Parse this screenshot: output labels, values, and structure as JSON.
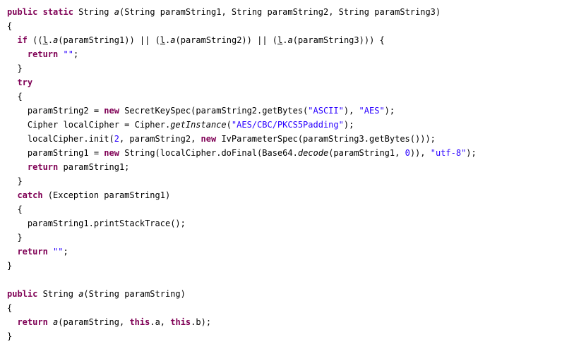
{
  "editor": {
    "lines": [
      [
        {
          "t": "public",
          "c": "kw"
        },
        {
          "t": " "
        },
        {
          "t": "static",
          "c": "kw"
        },
        {
          "t": " String "
        },
        {
          "t": "a",
          "c": "it"
        },
        {
          "t": "(String paramString1, String paramString2, String paramString3)"
        }
      ],
      [
        {
          "t": "{"
        }
      ],
      [
        {
          "t": "  "
        },
        {
          "t": "if",
          "c": "kw"
        },
        {
          "t": " (("
        },
        {
          "t": "l",
          "c": "ul"
        },
        {
          "t": "."
        },
        {
          "t": "a",
          "c": "it"
        },
        {
          "t": "(paramString1)) || ("
        },
        {
          "t": "l",
          "c": "ul"
        },
        {
          "t": "."
        },
        {
          "t": "a",
          "c": "it"
        },
        {
          "t": "(paramString2)) || ("
        },
        {
          "t": "l",
          "c": "ul"
        },
        {
          "t": "."
        },
        {
          "t": "a",
          "c": "it"
        },
        {
          "t": "(paramString3))) {"
        }
      ],
      [
        {
          "t": "    "
        },
        {
          "t": "return",
          "c": "kw"
        },
        {
          "t": " "
        },
        {
          "t": "\"\"",
          "c": "str"
        },
        {
          "t": ";"
        }
      ],
      [
        {
          "t": "  }"
        }
      ],
      [
        {
          "t": "  "
        },
        {
          "t": "try",
          "c": "kw"
        }
      ],
      [
        {
          "t": "  {"
        }
      ],
      [
        {
          "t": "    paramString2 = "
        },
        {
          "t": "new",
          "c": "kw"
        },
        {
          "t": " SecretKeySpec(paramString2.getBytes("
        },
        {
          "t": "\"ASCII\"",
          "c": "str"
        },
        {
          "t": "), "
        },
        {
          "t": "\"AES\"",
          "c": "str"
        },
        {
          "t": ");"
        }
      ],
      [
        {
          "t": "    Cipher localCipher = Cipher."
        },
        {
          "t": "getInstance",
          "c": "it"
        },
        {
          "t": "("
        },
        {
          "t": "\"AES/CBC/PKCS5Padding\"",
          "c": "str"
        },
        {
          "t": ");"
        }
      ],
      [
        {
          "t": "    localCipher.init("
        },
        {
          "t": "2",
          "c": "num"
        },
        {
          "t": ", paramString2, "
        },
        {
          "t": "new",
          "c": "kw"
        },
        {
          "t": " IvParameterSpec(paramString3.getBytes()));"
        }
      ],
      [
        {
          "t": "    paramString1 = "
        },
        {
          "t": "new",
          "c": "kw"
        },
        {
          "t": " String(localCipher.doFinal(Base64."
        },
        {
          "t": "decode",
          "c": "it"
        },
        {
          "t": "(paramString1, "
        },
        {
          "t": "0",
          "c": "num"
        },
        {
          "t": ")), "
        },
        {
          "t": "\"utf-8\"",
          "c": "str"
        },
        {
          "t": ");"
        }
      ],
      [
        {
          "t": "    "
        },
        {
          "t": "return",
          "c": "kw"
        },
        {
          "t": " paramString1;"
        }
      ],
      [
        {
          "t": "  }"
        }
      ],
      [
        {
          "t": "  "
        },
        {
          "t": "catch",
          "c": "kw"
        },
        {
          "t": " (Exception paramString1)"
        }
      ],
      [
        {
          "t": "  {"
        }
      ],
      [
        {
          "t": "    paramString1.printStackTrace();"
        }
      ],
      [
        {
          "t": "  }"
        }
      ],
      [
        {
          "t": "  "
        },
        {
          "t": "return",
          "c": "kw"
        },
        {
          "t": " "
        },
        {
          "t": "\"\"",
          "c": "str"
        },
        {
          "t": ";"
        }
      ],
      [
        {
          "t": "}"
        }
      ],
      [
        {
          "t": ""
        }
      ],
      [
        {
          "t": "public",
          "c": "kw"
        },
        {
          "t": " String "
        },
        {
          "t": "a",
          "c": "it"
        },
        {
          "t": "(String paramString)"
        }
      ],
      [
        {
          "t": "{"
        }
      ],
      [
        {
          "t": "  "
        },
        {
          "t": "return",
          "c": "kw"
        },
        {
          "t": " "
        },
        {
          "t": "a",
          "c": "it"
        },
        {
          "t": "(paramString, "
        },
        {
          "t": "this",
          "c": "kw"
        },
        {
          "t": ".a, "
        },
        {
          "t": "this",
          "c": "kw"
        },
        {
          "t": ".b);"
        }
      ],
      [
        {
          "t": "}"
        }
      ]
    ]
  }
}
